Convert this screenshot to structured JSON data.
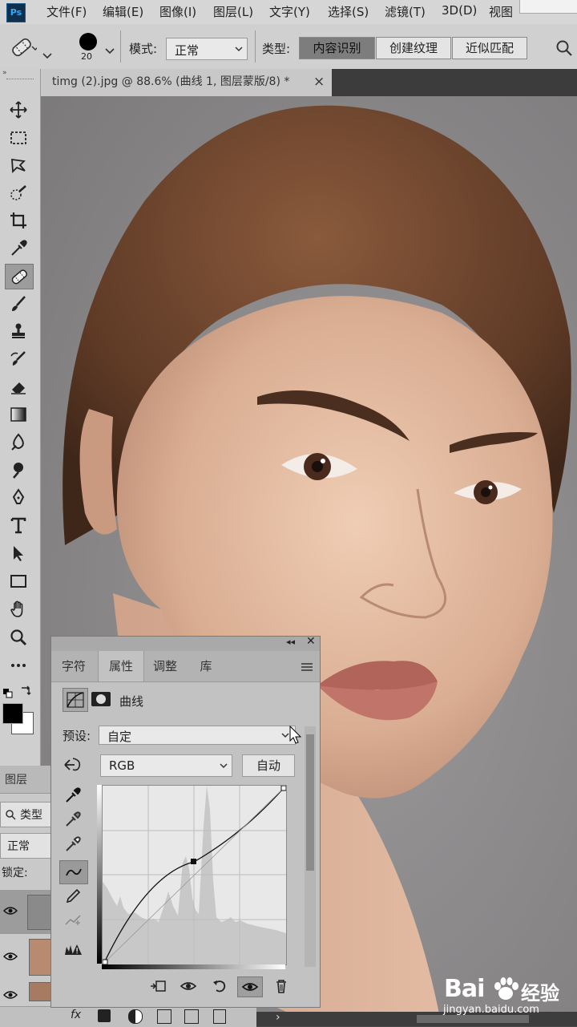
{
  "app": {
    "logo": "Ps"
  },
  "menu": [
    "文件(F)",
    "编辑(E)",
    "图像(I)",
    "图层(L)",
    "文字(Y)",
    "选择(S)",
    "滤镜(T)",
    "3D(D)",
    "视图"
  ],
  "options": {
    "brush_size": "20",
    "mode_label": "模式:",
    "mode_value": "正常",
    "type_label": "类型:",
    "type_buttons": [
      "内容识别",
      "创建纹理",
      "近似匹配"
    ]
  },
  "document": {
    "tab_title": "timg (2).jpg @ 88.6% (曲线 1, 图层蒙版/8) *",
    "close": "×"
  },
  "tools": [
    "move-icon",
    "marquee-icon",
    "lasso-icon",
    "quick-select-icon",
    "crop-icon",
    "eyedropper-icon",
    "healing-brush-icon",
    "brush-icon",
    "clone-stamp-icon",
    "history-brush-icon",
    "eraser-icon",
    "gradient-icon",
    "blur-icon",
    "dodge-icon",
    "pen-icon",
    "type-icon",
    "path-select-icon",
    "rectangle-icon",
    "hand-icon",
    "zoom-icon",
    "more-icon"
  ],
  "layers_panel": {
    "tab": "图层",
    "filter": "类型",
    "blend": "正常",
    "lock": "锁定:"
  },
  "properties": {
    "tabs": [
      "字符",
      "属性",
      "调整",
      "库"
    ],
    "active_tab": "属性",
    "title": "曲线",
    "preset_label": "预设:",
    "preset_value": "自定",
    "channel_value": "RGB",
    "auto_label": "自动"
  },
  "watermark": {
    "brand": "Bai",
    "brand2": "经验",
    "url": "jingyan.baidu.com"
  },
  "colors": {
    "accent": "#0f2f4f",
    "panel": "#c2c2c2",
    "toolbar": "#cfcfcf"
  }
}
